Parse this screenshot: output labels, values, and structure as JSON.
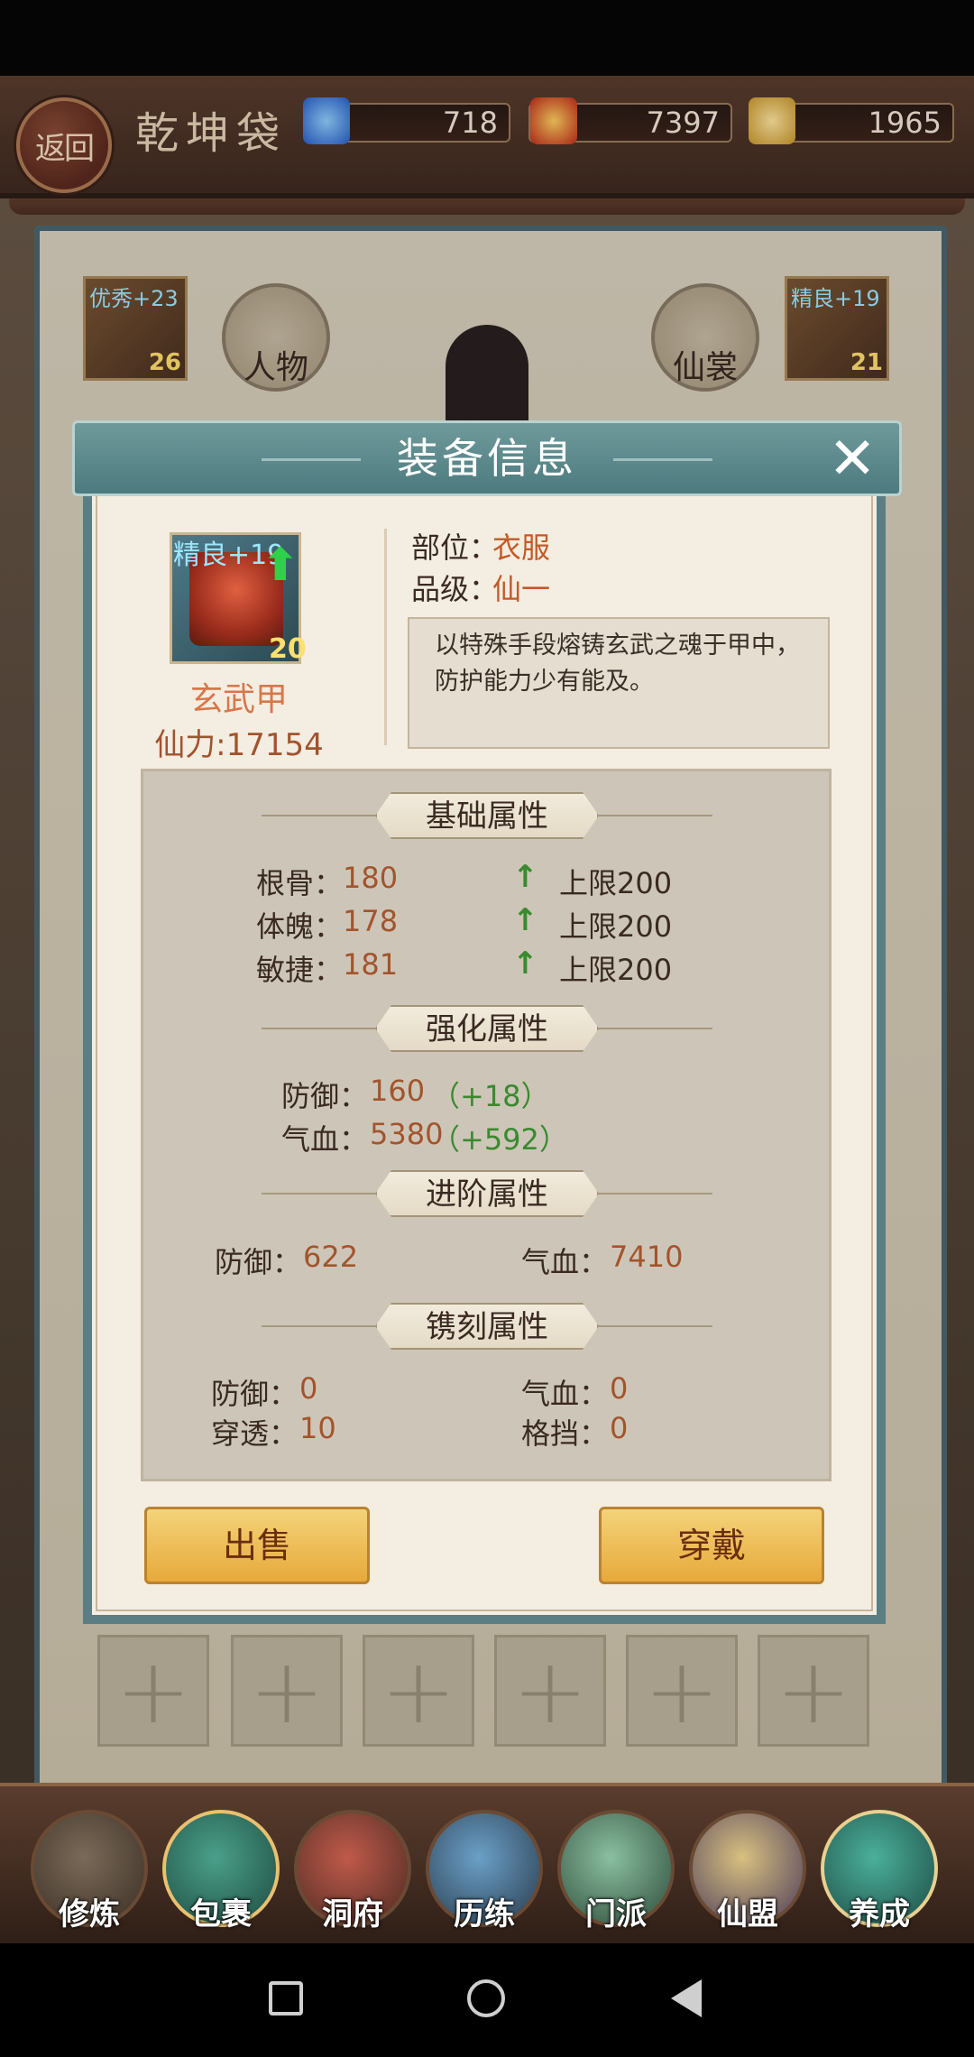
{
  "topbar": {
    "back_label": "返回",
    "title": "乾坤袋",
    "resources": [
      {
        "icon": "crystal-icon",
        "value": "718"
      },
      {
        "icon": "gift-bag-icon",
        "value": "7397"
      },
      {
        "icon": "scroll-icon",
        "value": "1965"
      }
    ]
  },
  "background": {
    "left_item_badge": "优秀+23",
    "left_item_level": "26",
    "right_item_badge": "精良+19",
    "right_item_level": "21",
    "tab_character": "人物",
    "tab_costume": "仙裳"
  },
  "modal": {
    "title": "装备信息",
    "close_label": "✕",
    "item": {
      "quality_badge": "精良+19",
      "level": "20",
      "name": "玄武甲",
      "power": "仙力:17154",
      "slot_label": "部位：",
      "slot_value": "衣服",
      "grade_label": "品级：",
      "grade_value": "仙一",
      "description": "以特殊手段熔铸玄武之魂于甲中，防护能力少有能及。"
    },
    "sections": {
      "basic": {
        "title": "基础属性",
        "rows": [
          {
            "label": "根骨：",
            "value": "180",
            "limit": "上限200"
          },
          {
            "label": "体魄：",
            "value": "178",
            "limit": "上限200"
          },
          {
            "label": "敏捷：",
            "value": "181",
            "limit": "上限200"
          }
        ]
      },
      "enhance": {
        "title": "强化属性",
        "rows": [
          {
            "label": "防御：",
            "value": "160",
            "bonus": "（+18）"
          },
          {
            "label": "气血：",
            "value": "5380",
            "bonus": "（+592）"
          }
        ]
      },
      "advance": {
        "title": "进阶属性",
        "defense_label": "防御：",
        "defense_value": "622",
        "hp_label": "气血：",
        "hp_value": "7410"
      },
      "engrave": {
        "title": "镌刻属性",
        "defense_label": "防御：",
        "defense_value": "0",
        "hp_label": "气血：",
        "hp_value": "0",
        "pierce_label": "穿透：",
        "pierce_value": "10",
        "block_label": "格挡：",
        "block_value": "0"
      }
    },
    "sell_button": "出售",
    "equip_button": "穿戴"
  },
  "empty_slots": [
    "+",
    "+",
    "+",
    "+",
    "+",
    "+"
  ],
  "bottom_nav": [
    {
      "label": "修炼",
      "icon": "cultivator-icon"
    },
    {
      "label": "包裹",
      "icon": "bag-icon"
    },
    {
      "label": "洞府",
      "icon": "cave-palace-icon"
    },
    {
      "label": "历练",
      "icon": "training-scroll-icon"
    },
    {
      "label": "门派",
      "icon": "sect-gate-icon"
    },
    {
      "label": "仙盟",
      "icon": "alliance-crown-icon"
    },
    {
      "label": "养成",
      "icon": "pentagram-icon"
    }
  ],
  "colors": {
    "accent_teal": "#5a7e84",
    "value_orange": "#a3542c",
    "bonus_green": "#3a8a30",
    "button_gold": "#e7a93a"
  }
}
